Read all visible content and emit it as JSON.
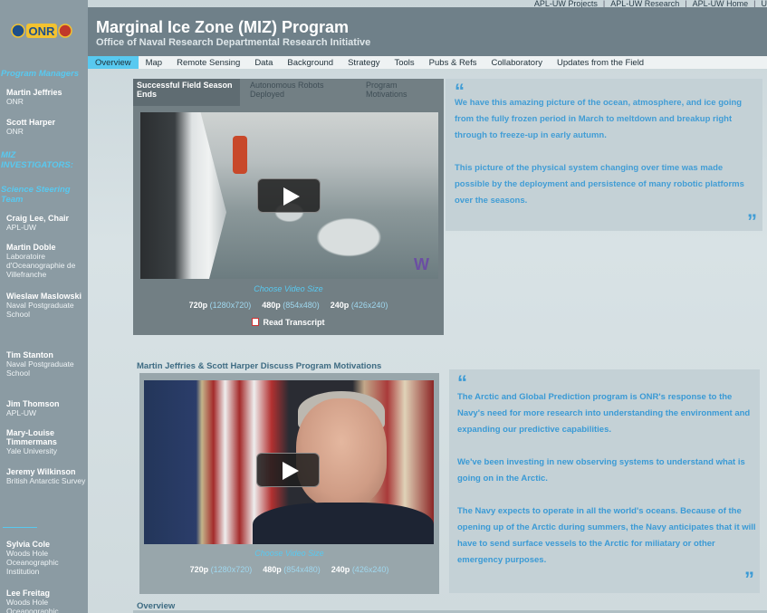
{
  "top_links": [
    "APL-UW Projects",
    "APL-UW Research",
    "APL-UW Home",
    "U"
  ],
  "header": {
    "title": "Marginal Ice Zone (MIZ) Program",
    "subtitle": "Office of Naval Research Departmental Research Initiative"
  },
  "logo_text": "ONR",
  "nav": [
    {
      "label": "Overview",
      "active": true
    },
    {
      "label": "Map"
    },
    {
      "label": "Remote Sensing"
    },
    {
      "label": "Data"
    },
    {
      "label": "Background"
    },
    {
      "label": "Strategy"
    },
    {
      "label": "Tools"
    },
    {
      "label": "Pubs & Refs"
    },
    {
      "label": "Collaboratory"
    },
    {
      "label": "Updates from the Field"
    }
  ],
  "sidebar": {
    "program_managers_heading": "Program Managers",
    "managers": [
      {
        "name": "Martin Jeffries",
        "org": "ONR"
      },
      {
        "name": "Scott Harper",
        "org": "ONR"
      }
    ],
    "investigators_heading": "MIZ INVESTIGATORS:",
    "steering_heading": "Science Steering Team",
    "steering": [
      {
        "name": "Craig Lee, Chair",
        "org": "APL-UW"
      },
      {
        "name": "Martin Doble",
        "org": "Laboratoire d'Oceanographie de Villefranche"
      },
      {
        "name": "Wieslaw Maslowski",
        "org": "Naval Postgraduate School"
      },
      {
        "name": "Tim Stanton",
        "org": "Naval Postgraduate School"
      },
      {
        "name": "Jim Thomson",
        "org": "APL-UW"
      },
      {
        "name": "Mary-Louise Timmermans",
        "org": "Yale University"
      },
      {
        "name": "Jeremy Wilkinson",
        "org": "British Antarctic Survey"
      }
    ],
    "others": [
      {
        "name": "Sylvia Cole",
        "org": "Woods Hole Oceanographic Institution"
      },
      {
        "name": "Lee Freitag",
        "org": "Woods Hole Oceanographic"
      }
    ]
  },
  "video_panel_1": {
    "tabs": [
      "Successful Field Season Ends",
      "Autonomous Robots Deployed",
      "Program Motivations"
    ],
    "watermark": "W",
    "choose_label": "Choose Video Size",
    "sizes": [
      {
        "label": "720p",
        "dims": "(1280x720)"
      },
      {
        "label": "480p",
        "dims": "(854x480)"
      },
      {
        "label": "240p",
        "dims": "(426x240)"
      }
    ],
    "transcript_label": "Read Transcript"
  },
  "quote_1": {
    "open": "“",
    "close": "”",
    "paragraphs": [
      "We have this amazing picture of the ocean, atmosphere, and ice going from the fully frozen period in March to meltdown and breakup right through to freeze-up in early autumn.",
      "This picture of the physical system changing over time was made possible by the deployment and persistence of many robotic platforms over the seasons."
    ]
  },
  "section_2": {
    "title": "Martin Jeffries & Scott Harper Discuss Program Motivations",
    "choose_label": "Choose Video Size",
    "sizes": [
      {
        "label": "720p",
        "dims": "(1280x720)"
      },
      {
        "label": "480p",
        "dims": "(854x480)"
      },
      {
        "label": "240p",
        "dims": "(426x240)"
      }
    ]
  },
  "quote_2": {
    "open": "“",
    "close": "”",
    "paragraphs": [
      "The Arctic and Global Prediction program is ONR's response to the Navy's need for more research into understanding the environment and expanding our predictive capabilities.",
      "We've been investing in new observing systems to understand what is going on in the Arctic.",
      "The Navy expects to operate in all the world's oceans. Because of the opening up of the Arctic during summers, the Navy anticipates that it will have to send surface vessels to the Arctic for miliatary or other emergency purposes."
    ]
  },
  "bottom_heading": "Overview",
  "colors": {
    "accent": "#58c9f0",
    "quote_text": "#3a9ad5",
    "header_bg": "#6f8089",
    "sidebar_bg": "#8b9ba3"
  }
}
